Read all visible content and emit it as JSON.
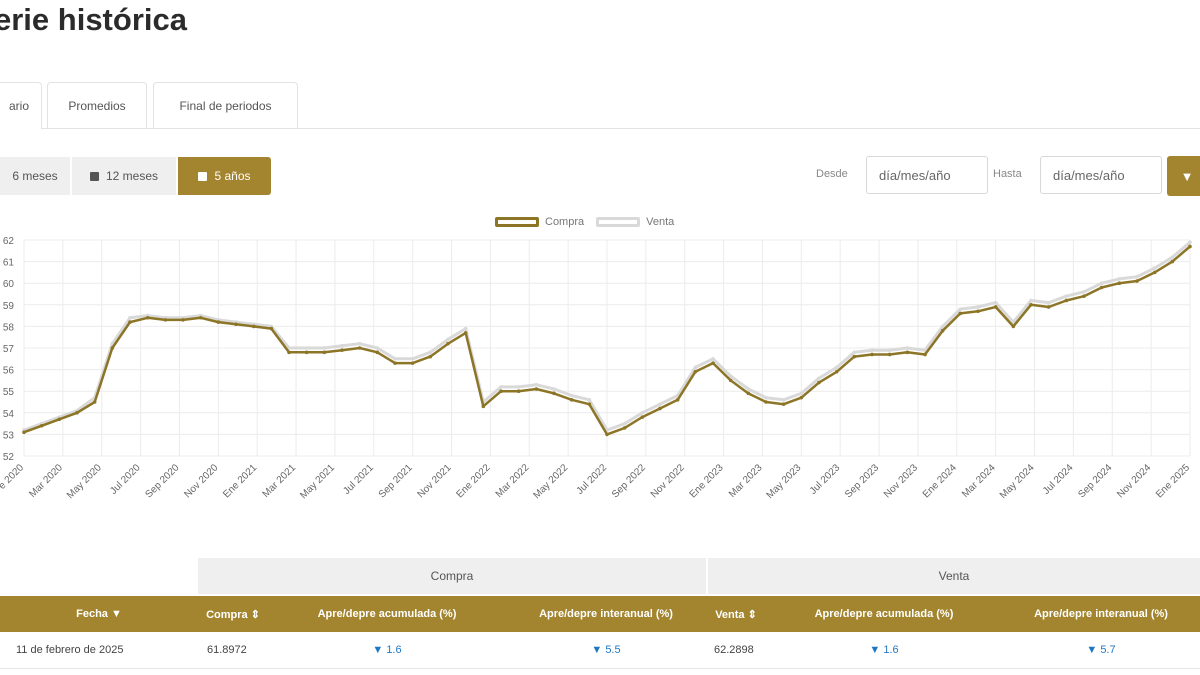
{
  "page": {
    "title": "erie histórica"
  },
  "tabs": [
    {
      "label": "ario",
      "active": true
    },
    {
      "label": "Promedios",
      "active": false
    },
    {
      "label": "Final de periodos",
      "active": false
    }
  ],
  "range_buttons": [
    {
      "label": "6 meses",
      "active": false
    },
    {
      "label": "12 meses",
      "active": false
    },
    {
      "label": "5 años",
      "active": true
    }
  ],
  "filters": {
    "from_label": "Desde",
    "from_placeholder": "día/mes/año",
    "to_label": "Hasta",
    "to_placeholder": "día/mes/año",
    "filter_icon": "filter-icon"
  },
  "colors": {
    "accent": "#a3852f",
    "compra": "#8c7526",
    "venta": "#d9d9d9",
    "pct": "#1f77c4"
  },
  "chart_data": {
    "type": "line",
    "legend": [
      "Compra",
      "Venta"
    ],
    "legend_position": "top-center",
    "grid": true,
    "ylim": [
      52,
      62
    ],
    "yticks": [
      "52",
      "53",
      "54",
      "55",
      "56",
      "57",
      "58",
      "59",
      "60",
      "61",
      "62"
    ],
    "categories": [
      "e 2020",
      "Mar 2020",
      "May 2020",
      "Jul 2020",
      "Sep 2020",
      "Nov 2020",
      "Ene 2021",
      "Mar 2021",
      "May 2021",
      "Jul 2021",
      "Sep 2021",
      "Nov 2021",
      "Ene 2022",
      "Mar 2022",
      "May 2022",
      "Jul 2022",
      "Sep 2022",
      "Nov 2022",
      "Ene 2023",
      "Mar 2023",
      "May 2023",
      "Jul 2023",
      "Sep 2023",
      "Nov 2023",
      "Ene 2024",
      "Mar 2024",
      "May 2024",
      "Jul 2024",
      "Sep 2024",
      "Nov 2024",
      "Ene 2025"
    ],
    "series": [
      {
        "name": "Compra",
        "values": [
          53.1,
          53.4,
          53.7,
          54.0,
          54.5,
          57.0,
          58.2,
          58.4,
          58.3,
          58.3,
          58.4,
          58.2,
          58.1,
          58.0,
          57.9,
          56.8,
          56.8,
          56.8,
          56.9,
          57.0,
          56.8,
          56.3,
          56.3,
          56.6,
          57.2,
          57.7,
          54.3,
          55.0,
          55.0,
          55.1,
          54.9,
          54.6,
          54.4,
          53.0,
          53.3,
          53.8,
          54.2,
          54.6,
          55.9,
          56.3,
          55.5,
          54.9,
          54.5,
          54.4,
          54.7,
          55.4,
          55.9,
          56.6,
          56.7,
          56.7,
          56.8,
          56.7,
          57.8,
          58.6,
          58.7,
          58.9,
          58.0,
          59.0,
          58.9,
          59.2,
          59.4,
          59.8,
          60.0,
          60.1,
          60.5,
          61.0,
          61.7
        ]
      },
      {
        "name": "Venta",
        "values": [
          53.2,
          53.5,
          53.8,
          54.1,
          54.7,
          57.2,
          58.4,
          58.5,
          58.4,
          58.4,
          58.5,
          58.3,
          58.2,
          58.1,
          58.0,
          57.0,
          57.0,
          57.0,
          57.1,
          57.2,
          57.0,
          56.5,
          56.5,
          56.8,
          57.4,
          57.9,
          54.5,
          55.2,
          55.2,
          55.3,
          55.1,
          54.8,
          54.6,
          53.2,
          53.5,
          54.0,
          54.4,
          54.8,
          56.1,
          56.5,
          55.7,
          55.1,
          54.7,
          54.6,
          54.9,
          55.6,
          56.1,
          56.8,
          56.9,
          56.9,
          57.0,
          56.9,
          58.0,
          58.8,
          58.9,
          59.1,
          58.2,
          59.2,
          59.1,
          59.4,
          59.6,
          60.0,
          60.2,
          60.3,
          60.7,
          61.2,
          61.9
        ]
      }
    ]
  },
  "table": {
    "groups": [
      "Compra",
      "Venta"
    ],
    "headers": [
      "Fecha ▼",
      "Compra ⇕",
      "Apre/depre acumulada (%)",
      "Apre/depre interanual (%)",
      "Venta ⇕",
      "Apre/depre acumulada (%)",
      "Apre/depre interanual (%)"
    ],
    "rows": [
      {
        "fecha": "11 de febrero de 2025",
        "compra": "61.8972",
        "c_acum": "▼ 1.6",
        "c_inter": "▼ 5.5",
        "venta": "62.2898",
        "v_acum": "▼ 1.6",
        "v_inter": "▼ 5.7"
      }
    ]
  }
}
